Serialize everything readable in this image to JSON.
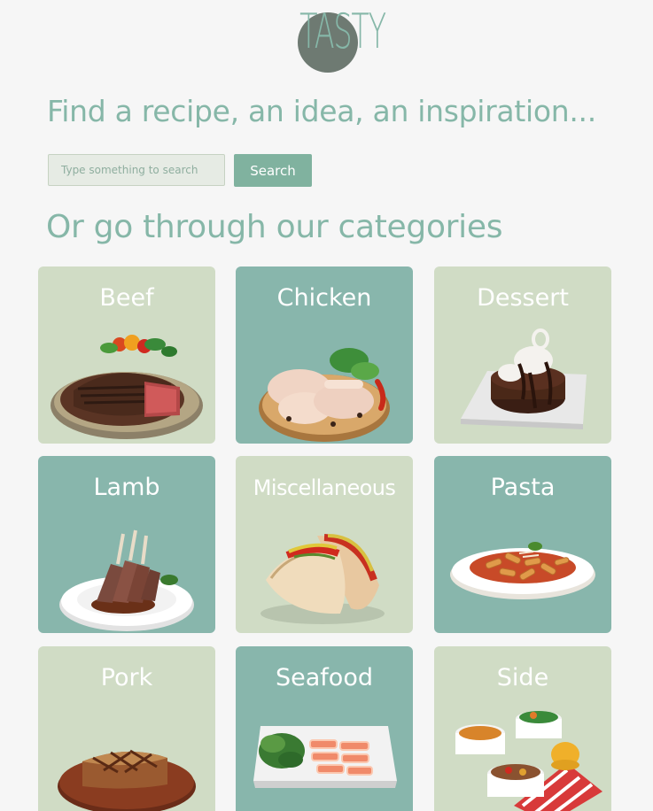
{
  "logo": {
    "text": "TASTY"
  },
  "headline": "Find a recipe, an idea, an inspiration...",
  "search": {
    "placeholder": "Type something to search",
    "value": "",
    "button_label": "Search"
  },
  "categories_heading": "Or go through our categories",
  "categories": [
    {
      "label": "Beef",
      "image": "beef-steak-image",
      "tone": "light"
    },
    {
      "label": "Chicken",
      "image": "raw-chicken-legs-image",
      "tone": "teal"
    },
    {
      "label": "Dessert",
      "image": "chocolate-cake-image",
      "tone": "light"
    },
    {
      "label": "Lamb",
      "image": "lamb-chops-image",
      "tone": "teal"
    },
    {
      "label": "Miscellaneous",
      "image": "tacos-image",
      "tone": "light"
    },
    {
      "label": "Pasta",
      "image": "penne-pasta-image",
      "tone": "teal"
    },
    {
      "label": "Pork",
      "image": "pork-chop-image",
      "tone": "light"
    },
    {
      "label": "Seafood",
      "image": "salmon-sashimi-image",
      "tone": "teal"
    },
    {
      "label": "Side",
      "image": "side-dishes-image",
      "tone": "light"
    }
  ],
  "colors": {
    "accent": "#86b7a8",
    "button": "#80b29f",
    "card_light": "#d0dcc5",
    "card_teal": "#88b6ac",
    "logo_circle": "#6e7a72",
    "background": "#f6f6f6"
  }
}
